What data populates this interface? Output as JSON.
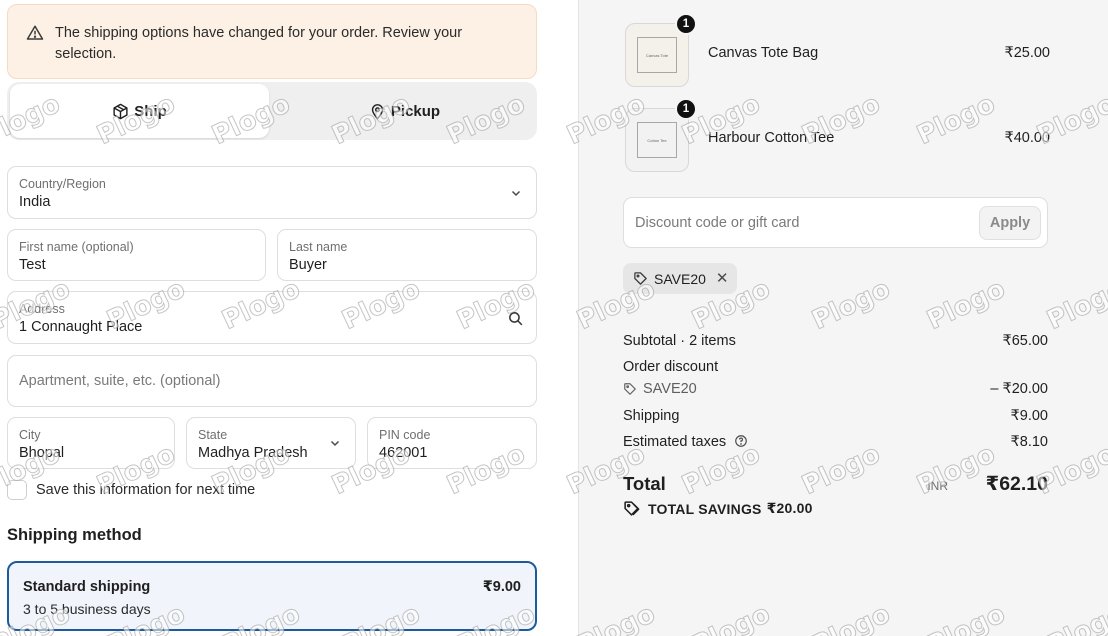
{
  "alert": {
    "message": "The shipping options have changed for your order. Review your selection."
  },
  "delivery": {
    "ship_label": "Ship",
    "pickup_label": "Pickup"
  },
  "form": {
    "country": {
      "label": "Country/Region",
      "value": "India"
    },
    "first_name": {
      "label": "First name (optional)",
      "value": "Test"
    },
    "last_name": {
      "label": "Last name",
      "value": "Buyer"
    },
    "address": {
      "label": "Address",
      "value": "1 Connaught Place"
    },
    "apartment": {
      "placeholder": "Apartment, suite, etc. (optional)"
    },
    "city": {
      "label": "City",
      "value": "Bhopal"
    },
    "state": {
      "label": "State",
      "value": "Madhya Pradesh"
    },
    "pin": {
      "label": "PIN code",
      "value": "462001"
    },
    "save_info_label": "Save this information for next time"
  },
  "shipping_method": {
    "title": "Shipping method",
    "option": {
      "name": "Standard shipping",
      "days": "3 to 5 business days",
      "price": "₹9.00"
    }
  },
  "cart": {
    "items": [
      {
        "name": "Canvas Tote Bag",
        "price": "₹25.00",
        "qty": "1",
        "thumb_text": "Canvas Tote"
      },
      {
        "name": "Harbour Cotton Tee",
        "price": "₹40.00",
        "qty": "1",
        "thumb_text": "Cotton Tee"
      }
    ]
  },
  "discount": {
    "placeholder": "Discount code or gift card",
    "apply_label": "Apply",
    "applied_code": "SAVE20"
  },
  "summary": {
    "subtotal_label": "Subtotal · 2 items",
    "subtotal_value": "₹65.00",
    "order_discount_label": "Order discount",
    "order_discount_code": "SAVE20",
    "order_discount_value": "– ₹20.00",
    "shipping_label": "Shipping",
    "shipping_value": "₹9.00",
    "taxes_label": "Estimated taxes",
    "taxes_value": "₹8.10",
    "total_label": "Total",
    "currency": "INR",
    "total_value": "₹62.10",
    "savings_label": "TOTAL SAVINGS",
    "savings_value": "₹20.00"
  },
  "watermark": {
    "text": "Plogo"
  },
  "colors": {
    "selected_border": "#1e5b9c",
    "alert_bg": "#fdf1e5",
    "panel_bg": "#f5f5f5"
  }
}
